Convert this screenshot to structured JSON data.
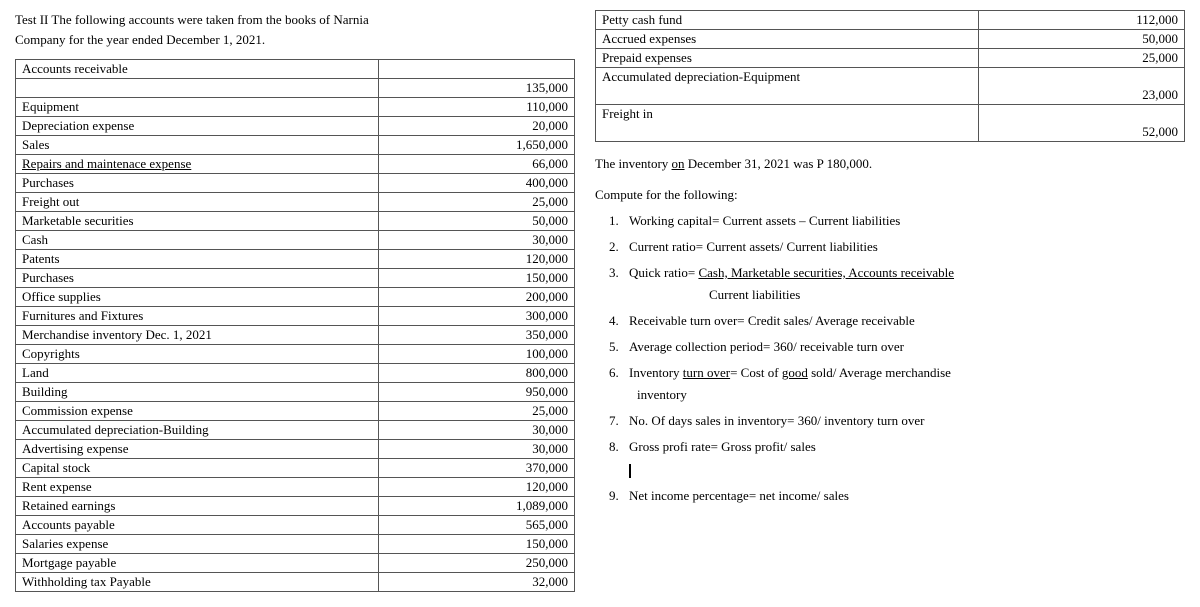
{
  "intro": {
    "line1": "Test II The following accounts were taken from the books of Narnia",
    "line2": "Company for the year ended December 1, 2021."
  },
  "leftTable": {
    "header": "Accounts receivable",
    "rows": [
      {
        "label": "",
        "value": "135,000"
      },
      {
        "label": "Equipment",
        "value": "110,000"
      },
      {
        "label": "Depreciation expense",
        "value": "20,000"
      },
      {
        "label": "Sales",
        "value": "1,650,000"
      },
      {
        "label": "Repairs and maintenace expense",
        "value": "66,000"
      },
      {
        "label": "Purchases",
        "value": "400,000"
      },
      {
        "label": "Freight out",
        "value": "25,000"
      },
      {
        "label": "Marketable securities",
        "value": "50,000"
      },
      {
        "label": "Cash",
        "value": "30,000"
      },
      {
        "label": "Patents",
        "value": "120,000"
      },
      {
        "label": "Purchases",
        "value": "150,000"
      },
      {
        "label": "Office supplies",
        "value": "200,000"
      },
      {
        "label": "Furnitures and Fixtures",
        "value": "300,000"
      },
      {
        "label": "Merchandise inventory Dec. 1, 2021",
        "value": "350,000"
      },
      {
        "label": "Copyrights",
        "value": "100,000"
      },
      {
        "label": "Land",
        "value": "800,000"
      },
      {
        "label": "Building",
        "value": "950,000"
      },
      {
        "label": "Commission expense",
        "value": "25,000"
      },
      {
        "label": "Accumulated depreciation-Building",
        "value": "30,000"
      },
      {
        "label": "Advertising expense",
        "value": "30,000"
      },
      {
        "label": "Capital stock",
        "value": "370,000"
      },
      {
        "label": "Rent expense",
        "value": "120,000"
      },
      {
        "label": "Retained earnings",
        "value": "1,089,000"
      },
      {
        "label": "Accounts payable",
        "value": "565,000"
      },
      {
        "label": "Salaries expense",
        "value": "150,000"
      },
      {
        "label": "Mortgage payable",
        "value": "250,000"
      },
      {
        "label": "Withholding tax Payable",
        "value": "32,000"
      }
    ]
  },
  "rightTopTable": {
    "rows": [
      {
        "label": "Petty cash fund",
        "value": "112,000",
        "hasTopEmpty": false
      },
      {
        "label": "Accrued expenses",
        "value": "50,000",
        "hasTopEmpty": false
      },
      {
        "label": "Prepaid expenses",
        "value": "25,000",
        "hasTopEmpty": false
      },
      {
        "label": "Accumulated depreciation-Equipment",
        "value": "",
        "hasTopEmpty": true,
        "bottomValue": "23,000"
      },
      {
        "label": "Freight in",
        "value": "",
        "hasTopEmpty": true,
        "bottomValue": "52,000"
      }
    ]
  },
  "inventoryNote": "The inventory on December 31, 2021 was P 180,000.",
  "compute": {
    "title": "Compute for the following:",
    "items": [
      {
        "num": "1.",
        "text": "Working capital= Current assets – Current liabilities"
      },
      {
        "num": "2.",
        "text": "Current ratio= Current assets/ Current liabilities"
      },
      {
        "num": "3.",
        "line1": "Quick ratio= Cash, Marketable securities, Accounts receivable",
        "line2": "Current liabilities"
      },
      {
        "num": "4.",
        "text": "Receivable turn over= Credit sales/ Average receivable"
      },
      {
        "num": "5.",
        "text": "Average collection period= 360/ receivable turn over"
      },
      {
        "num": "6.",
        "line1": "Inventory turn over= Cost of good sold/ Average merchandise",
        "line2": "inventory"
      },
      {
        "num": "7.",
        "text": "No. Of days sales in inventory= 360/ inventory turn over"
      },
      {
        "num": "8.",
        "text": "Gross profi rate= Gross profit/ sales"
      },
      {
        "num": "9.",
        "text": "Net income percentage= net income/ sales"
      }
    ]
  }
}
